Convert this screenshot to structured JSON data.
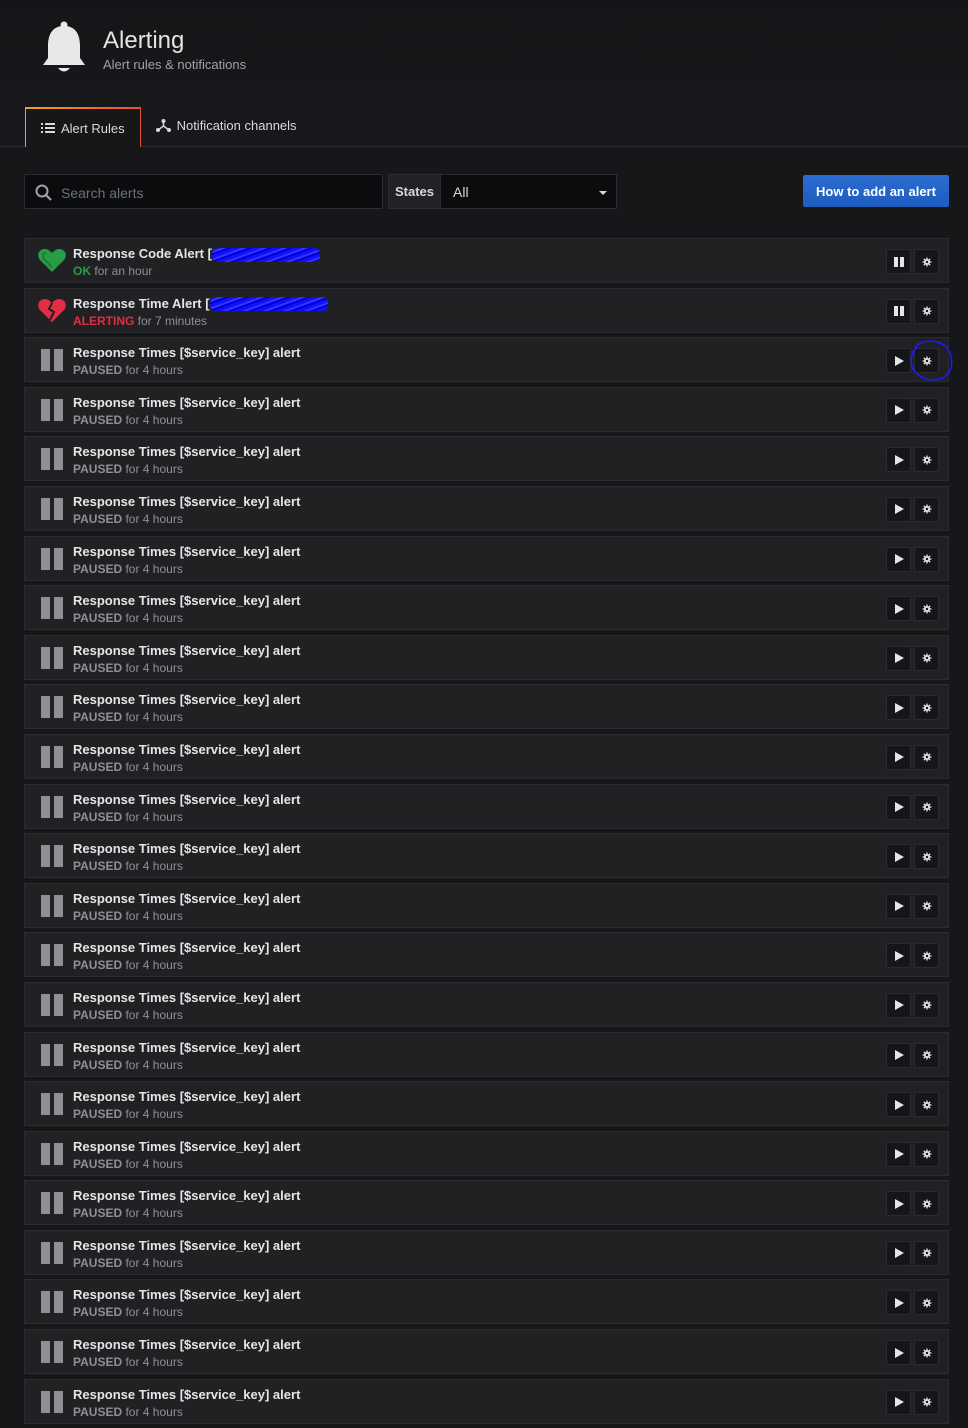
{
  "header": {
    "title": "Alerting",
    "subtitle": "Alert rules & notifications",
    "icon": "bell-icon"
  },
  "tabs": [
    {
      "label": "Alert Rules",
      "icon": "list-icon",
      "active": true
    },
    {
      "label": "Notification channels",
      "icon": "share-nodes-icon",
      "active": false
    }
  ],
  "toolbar": {
    "search_placeholder": "Search alerts",
    "search_value": "",
    "states_label": "States",
    "states_value": "All",
    "add_button_label": "How to add an alert"
  },
  "colors": {
    "ok": "#299c46",
    "alerting": "#e02f44",
    "paused": "#8e9094",
    "primary_button": "#1f60c4",
    "annotation_ink": "#0000ff"
  },
  "alerts": [
    {
      "name": "Response Code Alert [",
      "redacted": true,
      "state": "OK",
      "state_suffix": " for an hour",
      "status": "ok",
      "action": "pause"
    },
    {
      "name": "Response Time Alert [",
      "redacted": true,
      "state": "ALERTING",
      "state_suffix": " for 7 minutes",
      "status": "alerting",
      "action": "pause"
    },
    {
      "name": "Response Times [$service_key] alert",
      "state": "PAUSED",
      "state_suffix": " for 4 hours",
      "status": "paused",
      "action": "play"
    },
    {
      "name": "Response Times [$service_key] alert",
      "state": "PAUSED",
      "state_suffix": " for 4 hours",
      "status": "paused",
      "action": "play"
    },
    {
      "name": "Response Times [$service_key] alert",
      "state": "PAUSED",
      "state_suffix": " for 4 hours",
      "status": "paused",
      "action": "play"
    },
    {
      "name": "Response Times [$service_key] alert",
      "state": "PAUSED",
      "state_suffix": " for 4 hours",
      "status": "paused",
      "action": "play"
    },
    {
      "name": "Response Times [$service_key] alert",
      "state": "PAUSED",
      "state_suffix": " for 4 hours",
      "status": "paused",
      "action": "play"
    },
    {
      "name": "Response Times [$service_key] alert",
      "state": "PAUSED",
      "state_suffix": " for 4 hours",
      "status": "paused",
      "action": "play"
    },
    {
      "name": "Response Times [$service_key] alert",
      "state": "PAUSED",
      "state_suffix": " for 4 hours",
      "status": "paused",
      "action": "play"
    },
    {
      "name": "Response Times [$service_key] alert",
      "state": "PAUSED",
      "state_suffix": " for 4 hours",
      "status": "paused",
      "action": "play"
    },
    {
      "name": "Response Times [$service_key] alert",
      "state": "PAUSED",
      "state_suffix": " for 4 hours",
      "status": "paused",
      "action": "play"
    },
    {
      "name": "Response Times [$service_key] alert",
      "state": "PAUSED",
      "state_suffix": " for 4 hours",
      "status": "paused",
      "action": "play"
    },
    {
      "name": "Response Times [$service_key] alert",
      "state": "PAUSED",
      "state_suffix": " for 4 hours",
      "status": "paused",
      "action": "play"
    },
    {
      "name": "Response Times [$service_key] alert",
      "state": "PAUSED",
      "state_suffix": " for 4 hours",
      "status": "paused",
      "action": "play"
    },
    {
      "name": "Response Times [$service_key] alert",
      "state": "PAUSED",
      "state_suffix": " for 4 hours",
      "status": "paused",
      "action": "play"
    },
    {
      "name": "Response Times [$service_key] alert",
      "state": "PAUSED",
      "state_suffix": " for 4 hours",
      "status": "paused",
      "action": "play"
    },
    {
      "name": "Response Times [$service_key] alert",
      "state": "PAUSED",
      "state_suffix": " for 4 hours",
      "status": "paused",
      "action": "play"
    },
    {
      "name": "Response Times [$service_key] alert",
      "state": "PAUSED",
      "state_suffix": " for 4 hours",
      "status": "paused",
      "action": "play"
    },
    {
      "name": "Response Times [$service_key] alert",
      "state": "PAUSED",
      "state_suffix": " for 4 hours",
      "status": "paused",
      "action": "play"
    },
    {
      "name": "Response Times [$service_key] alert",
      "state": "PAUSED",
      "state_suffix": " for 4 hours",
      "status": "paused",
      "action": "play"
    },
    {
      "name": "Response Times [$service_key] alert",
      "state": "PAUSED",
      "state_suffix": " for 4 hours",
      "status": "paused",
      "action": "play"
    },
    {
      "name": "Response Times [$service_key] alert",
      "state": "PAUSED",
      "state_suffix": " for 4 hours",
      "status": "paused",
      "action": "play"
    },
    {
      "name": "Response Times [$service_key] alert",
      "state": "PAUSED",
      "state_suffix": " for 4 hours",
      "status": "paused",
      "action": "play"
    },
    {
      "name": "Response Times [$service_key] alert",
      "state": "PAUSED",
      "state_suffix": " for 4 hours",
      "status": "paused",
      "action": "play"
    }
  ],
  "row_icons": {
    "ok": "heart-icon",
    "alerting": "broken-heart-icon",
    "paused": "pause-icon",
    "pause_action": "pause-icon",
    "play_action": "play-icon",
    "edit_action": "gear-icon"
  }
}
